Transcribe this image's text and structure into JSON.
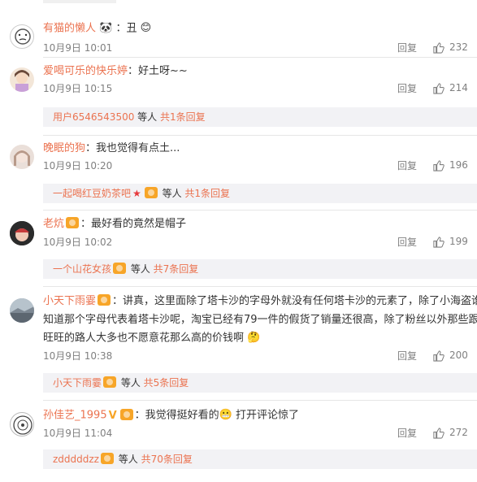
{
  "comments": [
    {
      "username": "有猫的懒人",
      "text": "：丑",
      "date": "10月9日",
      "time": "10:01",
      "reply_label": "回复",
      "likes": "232",
      "sub": null
    },
    {
      "username": "爱喝可乐的快乐婷",
      "text": "：好土呀~~",
      "date": "10月9日",
      "time": "10:15",
      "reply_label": "回复",
      "likes": "214",
      "sub": {
        "user": "用户6546543500",
        "suffix": " 等人 ",
        "count": "共1条回复"
      }
    },
    {
      "username": "晚眠的狗",
      "text": "：我也觉得有点土...",
      "date": "10月9日",
      "time": "10:20",
      "reply_label": "回复",
      "likes": "196",
      "sub": {
        "user": "一起喝红豆奶茶吧",
        "suffix": " 等人 ",
        "count": "共1条回复"
      }
    },
    {
      "username": "老炕",
      "text": "：最好看的竟然是帽子",
      "date": "10月9日",
      "time": "10:02",
      "reply_label": "回复",
      "likes": "199",
      "sub": {
        "user": "一个山花女孩",
        "suffix": " 等人 ",
        "count": "共7条回复"
      }
    },
    {
      "username": "小天下雨霎",
      "text_lines": [
        "：讲真，这里面除了塔卡沙的字母外就没有任何塔卡沙的元素了，除了小海盗谁又",
        "知道那个字母代表着塔卡沙呢，淘宝已经有79一件的假货了销量还很高，除了粉丝以外那些跟风穿",
        "旺旺的路人大多也不愿意花那么高的价钱啊"
      ],
      "date": "10月9日",
      "time": "10:38",
      "reply_label": "回复",
      "likes": "200",
      "sub": {
        "user": "小天下雨霎",
        "suffix": " 等人 ",
        "count": "共5条回复"
      }
    },
    {
      "username": "孙佳艺_1995",
      "text": "：我觉得挺好看的",
      "text_after": " 打开评论惊了",
      "date": "10月9日",
      "time": "11:04",
      "reply_label": "回复",
      "likes": "272",
      "sub": {
        "user": "zdddddzz",
        "suffix": " 等人 ",
        "count": "共70条回复"
      }
    }
  ],
  "icons": {
    "like": "thumbs-up-icon",
    "badge": "member-badge-icon"
  },
  "colors": {
    "username": "#eb7350",
    "meta": "#808080",
    "sub_bg": "#f2f2f5",
    "badge": "#f7a528"
  }
}
